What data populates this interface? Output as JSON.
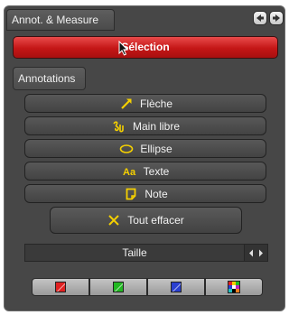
{
  "header": {
    "title": "Annot. & Measure"
  },
  "nav": {
    "prev_icon": "arrow-left-icon",
    "next_icon": "arrow-right-icon"
  },
  "selection": {
    "label": "Sélection",
    "cursor_icon": "mouse-pointer-icon",
    "color": "#d42323"
  },
  "annotations": {
    "section_label": "Annotations",
    "tools": [
      {
        "label": "Flèche",
        "icon": "arrow-tool-icon"
      },
      {
        "label": "Main libre",
        "icon": "freehand-tool-icon"
      },
      {
        "label": "Ellipse",
        "icon": "ellipse-tool-icon"
      },
      {
        "label": "Texte",
        "icon": "text-tool-icon"
      },
      {
        "label": "Note",
        "icon": "note-tool-icon"
      }
    ],
    "accent_color": "#f5d000"
  },
  "clear_all": {
    "label": "Tout effacer",
    "icon": "cross-icon"
  },
  "size": {
    "label": "Taille",
    "left_icon": "chevron-left-icon",
    "right_icon": "chevron-right-icon"
  },
  "colors": [
    {
      "name": "red",
      "hex": "#e02020"
    },
    {
      "name": "green",
      "hex": "#22b822"
    },
    {
      "name": "blue",
      "hex": "#2a3fd0"
    },
    {
      "name": "palette",
      "icon": "color-palette-icon"
    }
  ]
}
